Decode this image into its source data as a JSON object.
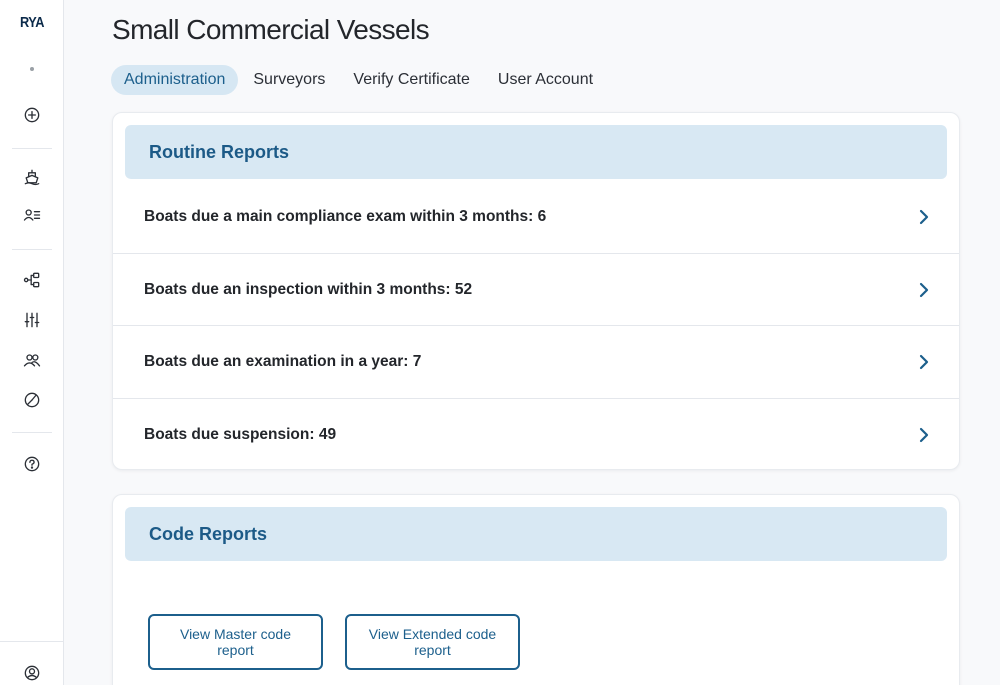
{
  "sidebar": {
    "logo": "RYA",
    "icons": [
      "add-circle-icon",
      "boat-icon",
      "user-list-icon",
      "workflow-icon",
      "sliders-icon",
      "users-icon",
      "pie-chart-icon",
      "help-icon",
      "account-icon"
    ]
  },
  "header": {
    "title": "Small Commercial Vessels"
  },
  "tabs": [
    {
      "label": "Administration",
      "active": true
    },
    {
      "label": "Surveyors",
      "active": false
    },
    {
      "label": "Verify Certificate",
      "active": false
    },
    {
      "label": "User Account",
      "active": false
    }
  ],
  "routine_reports": {
    "title": "Routine Reports",
    "items": [
      {
        "label": "Boats due a main compliance exam within 3 months: 6"
      },
      {
        "label": "Boats due an inspection within 3 months: 52"
      },
      {
        "label": "Boats due an examination in a year: 7"
      },
      {
        "label": "Boats due suspension: 49"
      }
    ]
  },
  "code_reports": {
    "title": "Code Reports",
    "buttons": [
      {
        "label": "View Master code report"
      },
      {
        "label": "View Extended code report"
      }
    ]
  },
  "colors": {
    "accent": "#1c5f8c",
    "header_bg": "#d8e8f3",
    "active_tab_bg": "#d6e7f3"
  }
}
